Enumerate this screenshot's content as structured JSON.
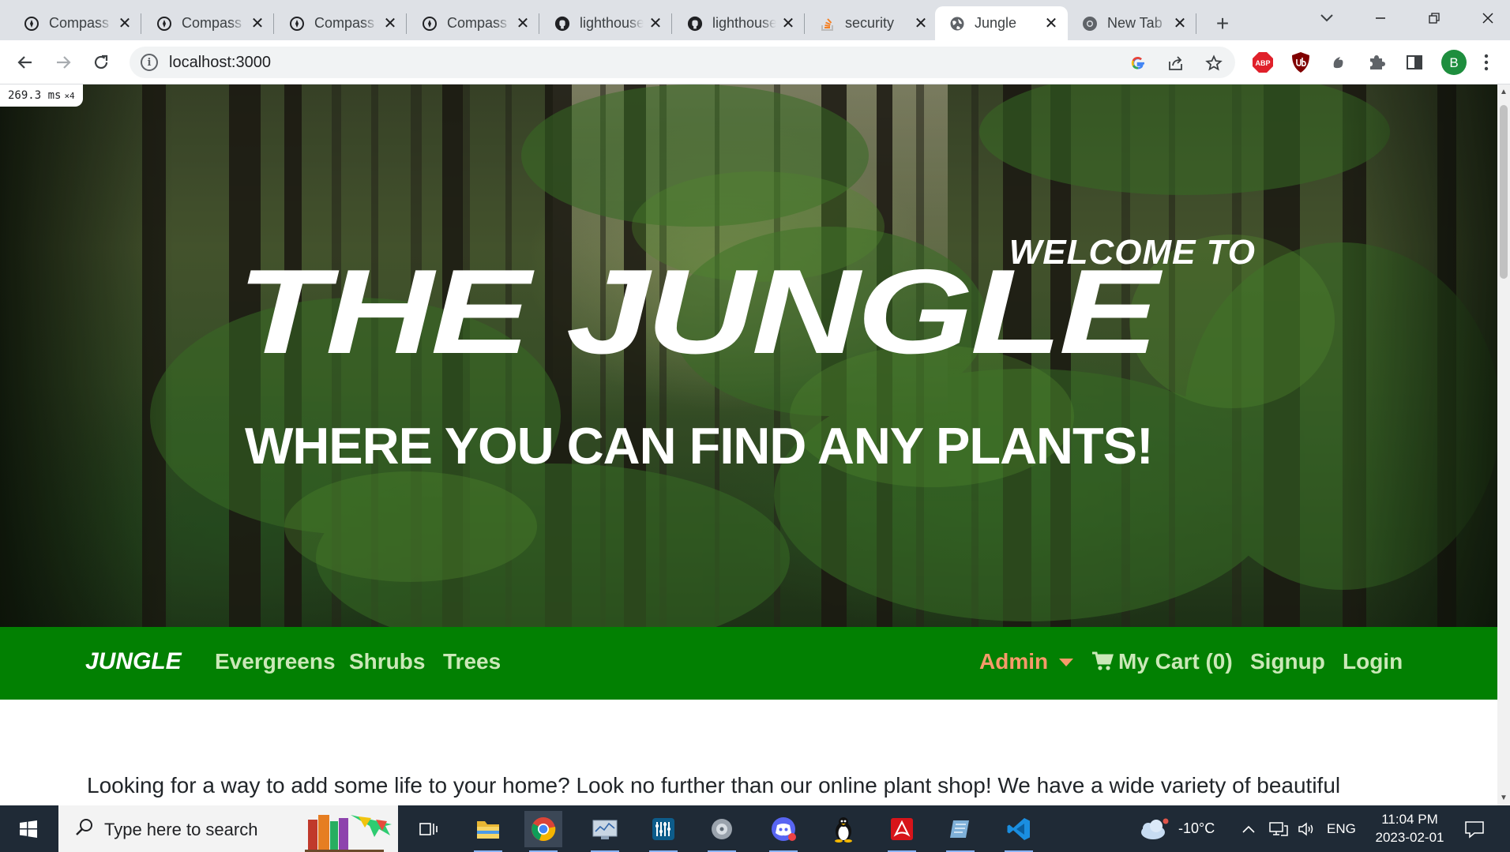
{
  "browser": {
    "tabs": [
      {
        "label": "Compass",
        "icon": "compass-icon",
        "active": false
      },
      {
        "label": "Compass",
        "icon": "compass-icon",
        "active": false
      },
      {
        "label": "Compass",
        "icon": "compass-icon",
        "active": false
      },
      {
        "label": "Compass",
        "icon": "compass-icon",
        "active": false
      },
      {
        "label": "lighthouse",
        "icon": "github-icon",
        "active": false
      },
      {
        "label": "lighthouse",
        "icon": "github-icon",
        "active": false
      },
      {
        "label": "security",
        "icon": "stackoverflow-icon",
        "active": false
      },
      {
        "label": "Jungle",
        "icon": "globe-icon",
        "active": true
      },
      {
        "label": "New Tab",
        "icon": "chrome-icon",
        "active": false
      }
    ],
    "close_glyph": "✕",
    "new_tab_glyph": "+",
    "address": "localhost:3000",
    "profile_initial": "B",
    "extensions": [
      "adblock-plus-icon",
      "ublock-icon",
      "sync-icon",
      "puzzle-icon",
      "sidepanel-icon"
    ],
    "abp_label": "ABP"
  },
  "page": {
    "perf_badge": {
      "value": "269.3 ms",
      "multiplier": "×4"
    },
    "hero": {
      "welcome": "WELCOME TO",
      "title": "THE JUNGLE",
      "subtitle": "WHERE YOU CAN FIND ANY PLANTS!"
    },
    "nav": {
      "brand": "JUNGLE",
      "links": [
        "Evergreens",
        "Shrubs",
        "Trees"
      ],
      "admin": "Admin",
      "cart": "My Cart (0)",
      "signup": "Signup",
      "login": "Login"
    },
    "intro": "Looking for a way to add some life to your home? Look no further than our online plant shop! We have a wide variety of beautiful"
  },
  "taskbar": {
    "search_placeholder": "Type here to search",
    "pinned": [
      "task-view-icon",
      "file-explorer-icon",
      "chrome-icon",
      "system-monitor-icon",
      "equalizer-app-icon",
      "audio-app-icon",
      "discord-icon",
      "linux-penguin-icon",
      "acrobat-icon",
      "notes-app-icon",
      "vscode-icon"
    ],
    "weather": "-10°C",
    "language": "ENG",
    "time": "11:04 PM",
    "date": "2023-02-01"
  },
  "colors": {
    "nav_green": "#028002",
    "nav_link": "#cbe8b8",
    "admin_orange": "#f79a6a",
    "tab_strip": "#dee1e6",
    "taskbar": "#1f2a36"
  }
}
